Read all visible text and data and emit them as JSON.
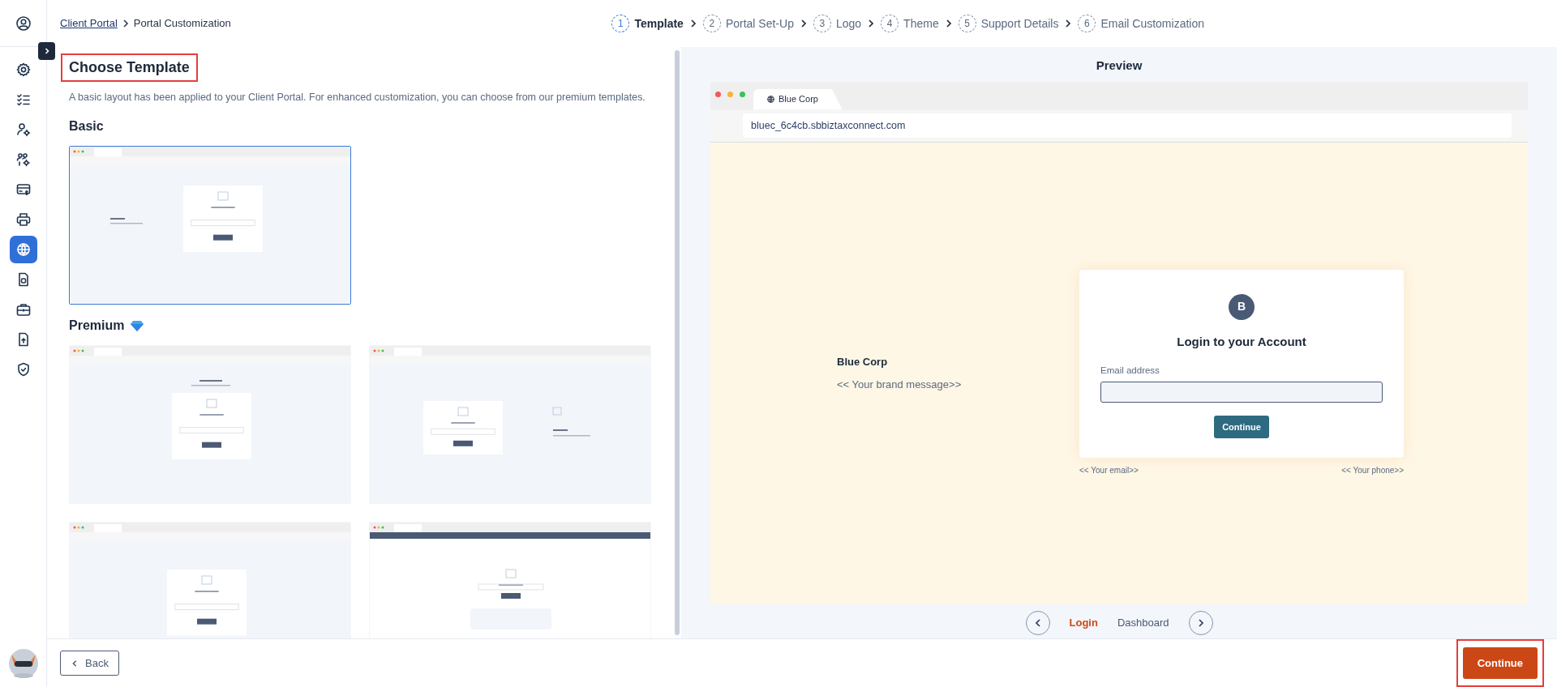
{
  "sidebar": {
    "items": [
      {
        "selected": false
      },
      {
        "selected": false
      },
      {
        "selected": false
      },
      {
        "selected": false
      },
      {
        "selected": false
      },
      {
        "selected": false
      },
      {
        "selected": true
      },
      {
        "selected": false
      },
      {
        "selected": false
      },
      {
        "selected": false
      },
      {
        "selected": false
      }
    ]
  },
  "breadcrumb": [
    {
      "label": "Client Portal",
      "kind": "link"
    },
    {
      "label": "Portal Customization",
      "kind": "current"
    }
  ],
  "stepper": [
    {
      "number": "1",
      "label": "Template",
      "selected": true
    },
    {
      "number": "2",
      "label": "Portal Set-Up",
      "selected": false
    },
    {
      "number": "3",
      "label": "Logo",
      "selected": false
    },
    {
      "number": "4",
      "label": "Theme",
      "selected": false
    },
    {
      "number": "5",
      "label": "Support Details",
      "selected": false
    },
    {
      "number": "6",
      "label": "Email Customization",
      "selected": false
    }
  ],
  "template_panel": {
    "title": "Choose Template",
    "title_highlighted": true,
    "subtitle": "A basic layout has been applied to your Client Portal. For enhanced customization, you can choose from our premium templates.",
    "sections": [
      {
        "heading": "Basic",
        "kind": "basic",
        "templates": [
          {
            "kind": "split",
            "selected": true
          }
        ]
      },
      {
        "heading": "Premium",
        "kind": "premium",
        "templates": [
          {
            "kind": "centered",
            "selected": false
          },
          {
            "kind": "reverse",
            "selected": false
          },
          {
            "kind": "stacked",
            "selected": false
          },
          {
            "kind": "header",
            "selected": false
          }
        ]
      }
    ]
  },
  "preview": {
    "title": "Preview",
    "tab_title": "Blue Corp",
    "url": "bluec_6c4cb.sbbiztaxconnect.com",
    "brand_name": "Blue Corp",
    "brand_message": "<< Your brand message>>",
    "login": {
      "avatar": "B",
      "title": "Login to your Account",
      "email_label": "Email address",
      "button": "Continue"
    },
    "footer_left": "<< Your email>>",
    "footer_right": "<< Your phone>>",
    "pages": [
      {
        "label": "Login",
        "selected": true
      },
      {
        "label": "Dashboard",
        "selected": false
      }
    ]
  },
  "footer": {
    "back": "Back",
    "continue": "Continue",
    "continue_highlighted": true
  }
}
